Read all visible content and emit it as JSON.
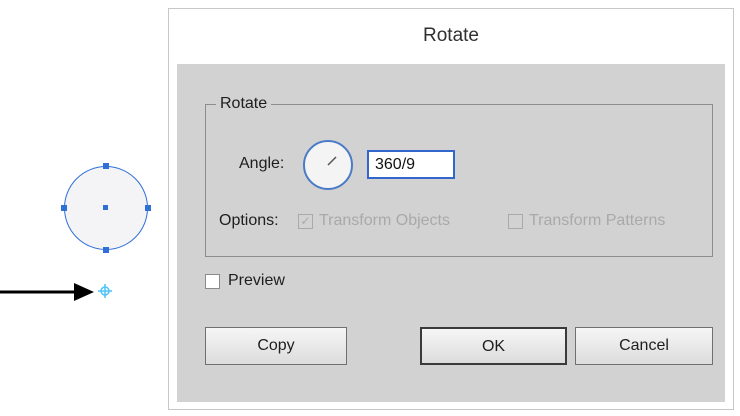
{
  "dialog": {
    "title": "Rotate",
    "group_label": "Rotate",
    "angle_label": "Angle:",
    "angle_value": "360/9",
    "options_label": "Options:",
    "transform_objects_label": "Transform Objects",
    "transform_objects_checked": true,
    "transform_patterns_label": "Transform Patterns",
    "transform_patterns_checked": false,
    "preview_label": "Preview",
    "preview_checked": false,
    "copy_label": "Copy",
    "ok_label": "OK",
    "cancel_label": "Cancel"
  },
  "colors": {
    "selection": "#2f6fd6",
    "origin_marker": "#4fc3f7",
    "dialog_body": "#d2d2d2",
    "arrow": "#000000"
  },
  "icons": {
    "dial": "angle-dial-icon",
    "origin": "rotation-origin-icon",
    "arrow": "arrow-right-icon"
  }
}
